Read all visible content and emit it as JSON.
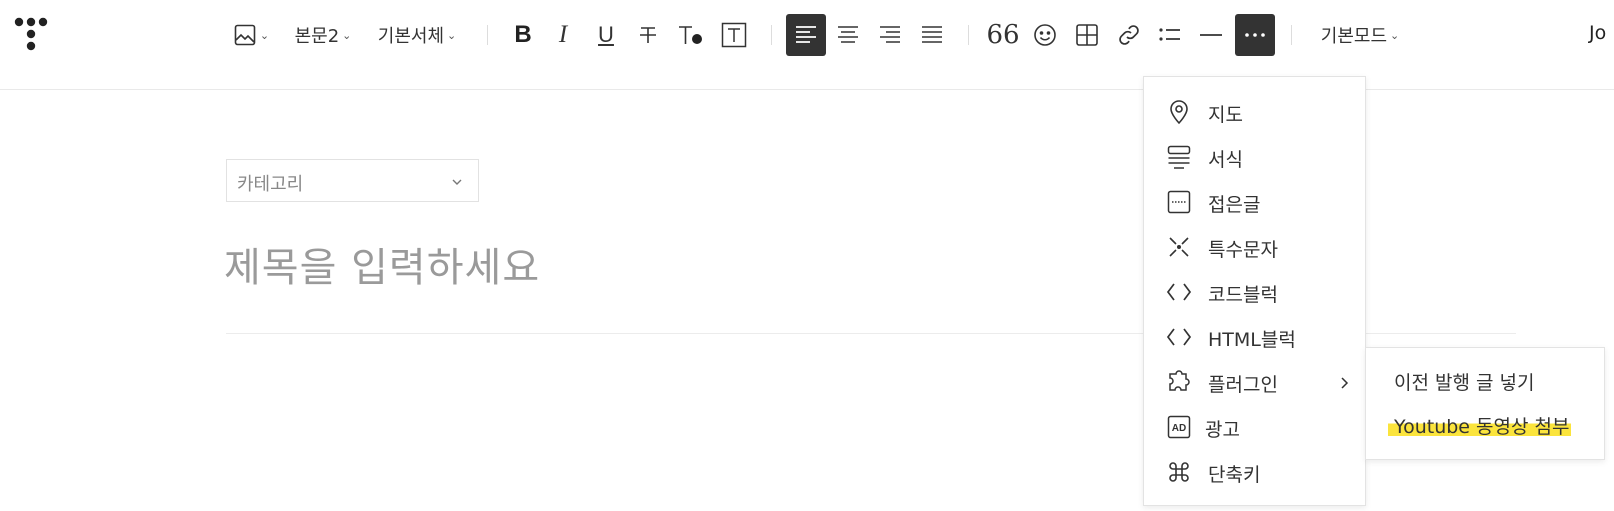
{
  "toolbar": {
    "image_button": "image-icon",
    "text_style": "본문2",
    "font_family": "기본서체",
    "mode": "기본모드",
    "user_name": "Jo"
  },
  "editor": {
    "category_placeholder": "카테고리",
    "title_placeholder": "제목을 입력하세요"
  },
  "more_menu": {
    "items": [
      {
        "label": "지도",
        "icon": "map-pin-icon"
      },
      {
        "label": "서식",
        "icon": "template-icon"
      },
      {
        "label": "접은글",
        "icon": "folded-text-icon"
      },
      {
        "label": "특수문자",
        "icon": "special-char-icon"
      },
      {
        "label": "코드블럭",
        "icon": "code-icon"
      },
      {
        "label": "HTML블럭",
        "icon": "html-code-icon"
      },
      {
        "label": "플러그인",
        "icon": "plugin-icon"
      },
      {
        "label": "광고",
        "icon": "ad-icon"
      },
      {
        "label": "단축키",
        "icon": "command-icon"
      }
    ]
  },
  "plugin_submenu": {
    "items": [
      {
        "label": "이전 발행 글 넣기"
      },
      {
        "label": "Youtube 동영상 첨부"
      }
    ]
  },
  "colors": {
    "active_bg": "#333333",
    "highlight": "#fbe43c"
  }
}
